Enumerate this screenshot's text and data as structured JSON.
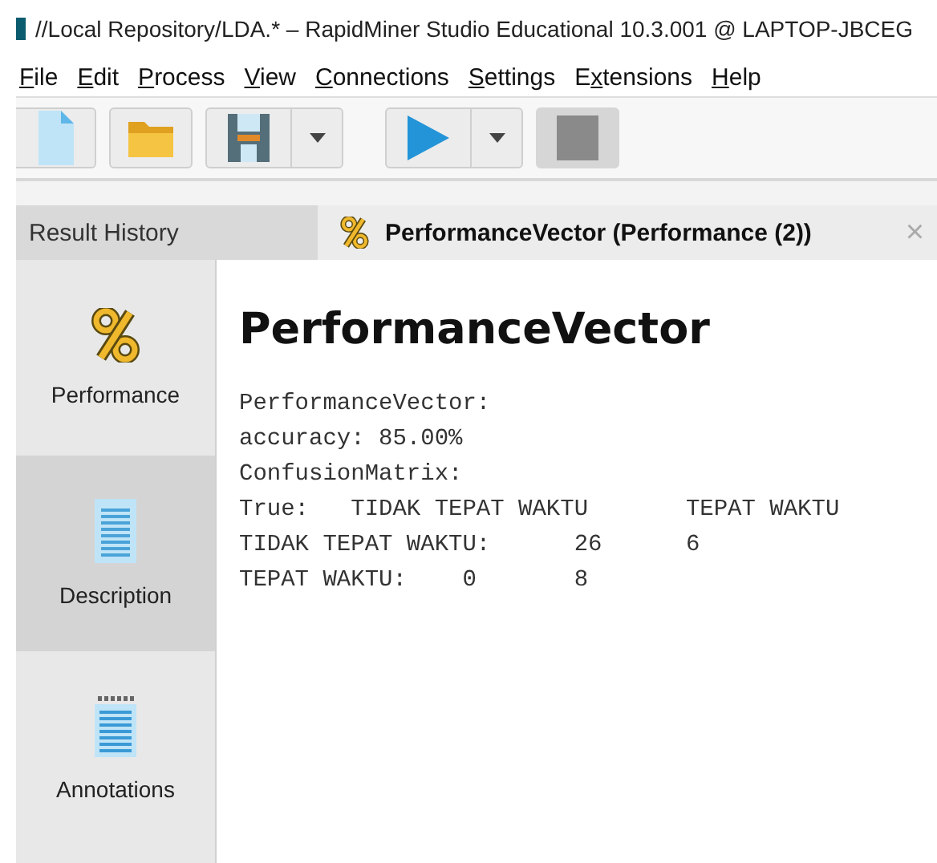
{
  "window": {
    "title": "//Local Repository/LDA.* – RapidMiner Studio Educational 10.3.001 @ LAPTOP-JBCEG"
  },
  "menu": [
    {
      "key": "F",
      "rest": "ile"
    },
    {
      "key": "E",
      "rest": "dit"
    },
    {
      "key": "P",
      "rest": "rocess"
    },
    {
      "key": "V",
      "rest": "iew"
    },
    {
      "key": "C",
      "rest": "onnections"
    },
    {
      "key": "S",
      "rest": "ettings"
    },
    {
      "lead": "E",
      "key": "x",
      "rest": "tensions"
    },
    {
      "key": "H",
      "rest": "elp"
    }
  ],
  "toolbar": [
    {
      "kind": "new",
      "disabled": false
    },
    {
      "kind": "open",
      "disabled": false
    },
    {
      "kind": "save",
      "disabled": false,
      "dropdown": true
    },
    {
      "kind": "run",
      "disabled": false,
      "dropdown": true
    },
    {
      "kind": "stop",
      "disabled": true
    }
  ],
  "tabs": [
    {
      "kind": "history",
      "label": "Result History",
      "selected": false
    },
    {
      "kind": "result",
      "label": "PerformanceVector (Performance (2))",
      "selected": true,
      "close": "×"
    }
  ],
  "sidebar": {
    "items": [
      {
        "kind": "performance",
        "label": "Performance",
        "selected": false
      },
      {
        "kind": "description",
        "label": "Description",
        "selected": true
      },
      {
        "kind": "annotations",
        "label": "Annotations",
        "selected": false
      }
    ]
  },
  "content": {
    "heading": "PerformanceVector",
    "lines": [
      "PerformanceVector:",
      "accuracy: 85.00%",
      "ConfusionMatrix:",
      "True:   TIDAK TEPAT WAKTU       TEPAT WAKTU",
      "TIDAK TEPAT WAKTU:      26      6",
      "TEPAT WAKTU:    0       8"
    ]
  }
}
